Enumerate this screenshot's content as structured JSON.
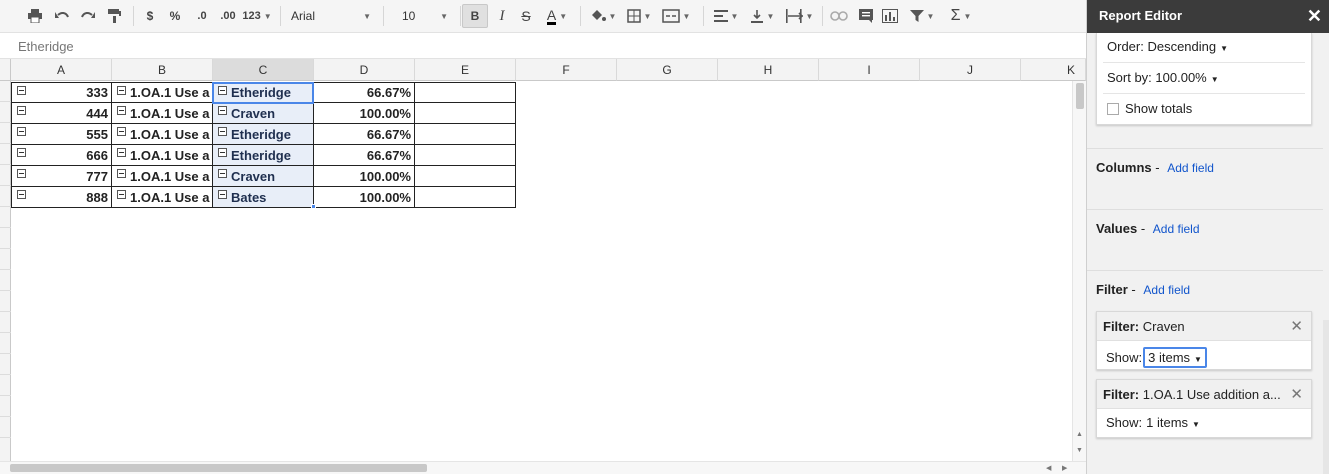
{
  "toolbar": {
    "buttons": [
      "print-icon",
      "undo-icon",
      "redo-icon",
      "paint-format-icon"
    ],
    "currency_label": "$",
    "percent_label": "%",
    "decrease_decimals_label": ".0",
    "increase_decimals_label": ".00",
    "more_formats_label": "123",
    "font_name": "Arial",
    "font_size": "10",
    "bold_label": "B",
    "italic_label": "I",
    "strike_label": "S",
    "text_color_label": "A"
  },
  "formula_bar": {
    "value": "Etheridge"
  },
  "columns": [
    "A",
    "B",
    "C",
    "D",
    "E",
    "F",
    "G",
    "H",
    "I",
    "J",
    "K"
  ],
  "rows": [
    {
      "a": "333",
      "b": "1.OA.1 Use a",
      "c": "Etheridge",
      "d": "66.67%"
    },
    {
      "a": "444",
      "b": "1.OA.1 Use a",
      "c": "Craven",
      "d": "100.00%"
    },
    {
      "a": "555",
      "b": "1.OA.1 Use a",
      "c": "Etheridge",
      "d": "66.67%"
    },
    {
      "a": "666",
      "b": "1.OA.1 Use a",
      "c": "Etheridge",
      "d": "66.67%"
    },
    {
      "a": "777",
      "b": "1.OA.1 Use a",
      "c": "Craven",
      "d": "100.00%"
    },
    {
      "a": "888",
      "b": "1.OA.1 Use a",
      "c": "Bates",
      "d": "100.00%"
    }
  ],
  "editor": {
    "title": "Report Editor",
    "close": "✕",
    "order": "Order: Descending",
    "sort_by": "Sort by: 100.00%",
    "show_totals": "Show totals",
    "columns_label": "Columns",
    "values_label": "Values",
    "filter_label": "Filter",
    "dash": "-",
    "add_field": "Add field",
    "filter1": {
      "prefix": "Filter:",
      "name": "Craven",
      "show_label": "Show:",
      "show_value": "3 items"
    },
    "filter2": {
      "prefix": "Filter:",
      "name": "1.OA.1 Use addition a...",
      "show_label": "Show:",
      "show_value": "1 items"
    }
  }
}
